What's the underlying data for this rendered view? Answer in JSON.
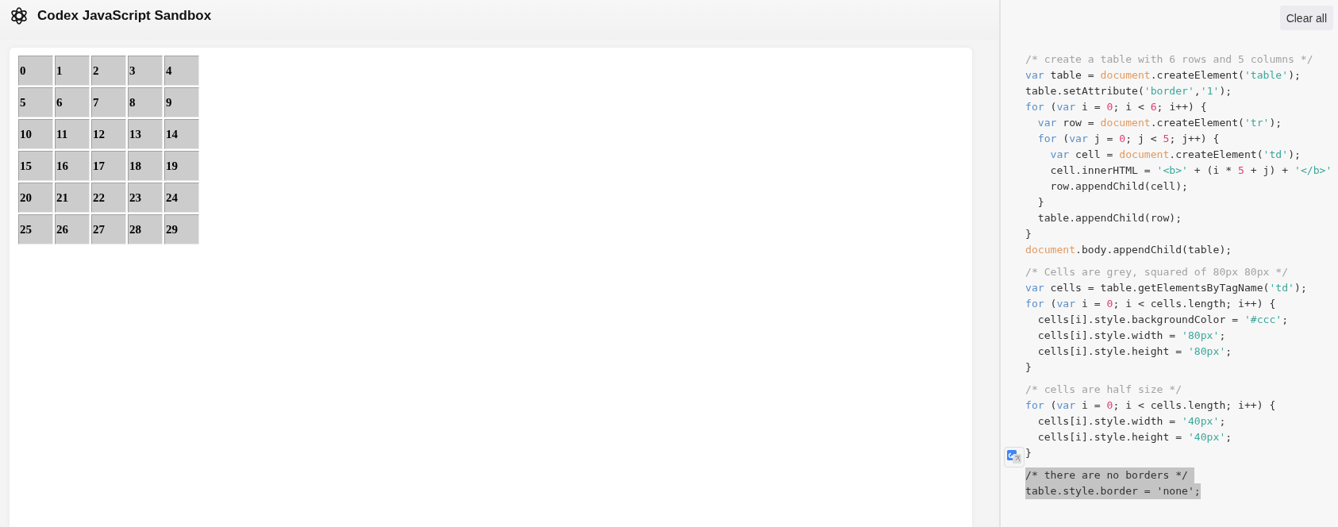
{
  "header": {
    "title": "Codex JavaScript Sandbox"
  },
  "output_table": {
    "rows": [
      [
        "0",
        "1",
        "2",
        "3",
        "4"
      ],
      [
        "5",
        "6",
        "7",
        "8",
        "9"
      ],
      [
        "10",
        "11",
        "12",
        "13",
        "14"
      ],
      [
        "15",
        "16",
        "17",
        "18",
        "19"
      ],
      [
        "20",
        "21",
        "22",
        "23",
        "24"
      ],
      [
        "25",
        "26",
        "27",
        "28",
        "29"
      ]
    ]
  },
  "clear_button": {
    "label": "Clear all"
  },
  "code": {
    "blocks": [
      {
        "highlighted": false,
        "lines": [
          [
            {
              "kind": "comment",
              "text": "/* create a table with 6 rows and 5 columns */"
            }
          ],
          [
            {
              "kind": "keyword",
              "text": "var"
            },
            {
              "kind": "plain",
              "text": " table = "
            },
            {
              "kind": "builtin",
              "text": "document"
            },
            {
              "kind": "plain",
              "text": ".createElement("
            },
            {
              "kind": "string",
              "text": "'table'"
            },
            {
              "kind": "plain",
              "text": ");"
            }
          ],
          [
            {
              "kind": "plain",
              "text": "table.setAttribute("
            },
            {
              "kind": "string",
              "text": "'border'"
            },
            {
              "kind": "plain",
              "text": ","
            },
            {
              "kind": "string",
              "text": "'1'"
            },
            {
              "kind": "plain",
              "text": ");"
            }
          ],
          [
            {
              "kind": "keyword",
              "text": "for"
            },
            {
              "kind": "plain",
              "text": " ("
            },
            {
              "kind": "keyword",
              "text": "var"
            },
            {
              "kind": "plain",
              "text": " i = "
            },
            {
              "kind": "number",
              "text": "0"
            },
            {
              "kind": "plain",
              "text": "; i < "
            },
            {
              "kind": "number",
              "text": "6"
            },
            {
              "kind": "plain",
              "text": "; i++) {"
            }
          ],
          [
            {
              "kind": "keyword",
              "text": "  var"
            },
            {
              "kind": "plain",
              "text": " row = "
            },
            {
              "kind": "builtin",
              "text": "document"
            },
            {
              "kind": "plain",
              "text": ".createElement("
            },
            {
              "kind": "string",
              "text": "'tr'"
            },
            {
              "kind": "plain",
              "text": ");"
            }
          ],
          [
            {
              "kind": "keyword",
              "text": "  for"
            },
            {
              "kind": "plain",
              "text": " ("
            },
            {
              "kind": "keyword",
              "text": "var"
            },
            {
              "kind": "plain",
              "text": " j = "
            },
            {
              "kind": "number",
              "text": "0"
            },
            {
              "kind": "plain",
              "text": "; j < "
            },
            {
              "kind": "number",
              "text": "5"
            },
            {
              "kind": "plain",
              "text": "; j++) {"
            }
          ],
          [
            {
              "kind": "keyword",
              "text": "    var"
            },
            {
              "kind": "plain",
              "text": " cell = "
            },
            {
              "kind": "builtin",
              "text": "document"
            },
            {
              "kind": "plain",
              "text": ".createElement("
            },
            {
              "kind": "string",
              "text": "'td'"
            },
            {
              "kind": "plain",
              "text": ");"
            }
          ],
          [
            {
              "kind": "plain",
              "text": "    cell.innerHTML = "
            },
            {
              "kind": "string",
              "text": "'<b>'"
            },
            {
              "kind": "plain",
              "text": " + (i * "
            },
            {
              "kind": "number",
              "text": "5"
            },
            {
              "kind": "plain",
              "text": " + j) + "
            },
            {
              "kind": "string",
              "text": "'</b>'"
            }
          ],
          [
            {
              "kind": "plain",
              "text": "    row.appendChild(cell);"
            }
          ],
          [
            {
              "kind": "plain",
              "text": "  }"
            }
          ],
          [
            {
              "kind": "plain",
              "text": "  table.appendChild(row);"
            }
          ],
          [
            {
              "kind": "plain",
              "text": "}"
            }
          ],
          [
            {
              "kind": "builtin",
              "text": "document"
            },
            {
              "kind": "plain",
              "text": ".body.appendChild(table);"
            }
          ]
        ]
      },
      {
        "highlighted": false,
        "lines": [
          [
            {
              "kind": "comment",
              "text": "/* Cells are grey, squared of 80px 80px */"
            }
          ],
          [
            {
              "kind": "keyword",
              "text": "var"
            },
            {
              "kind": "plain",
              "text": " cells = table.getElementsByTagName("
            },
            {
              "kind": "string",
              "text": "'td'"
            },
            {
              "kind": "plain",
              "text": ");"
            }
          ],
          [
            {
              "kind": "keyword",
              "text": "for"
            },
            {
              "kind": "plain",
              "text": " ("
            },
            {
              "kind": "keyword",
              "text": "var"
            },
            {
              "kind": "plain",
              "text": " i = "
            },
            {
              "kind": "number",
              "text": "0"
            },
            {
              "kind": "plain",
              "text": "; i < cells.length; i++) {"
            }
          ],
          [
            {
              "kind": "plain",
              "text": "  cells[i].style.backgroundColor = "
            },
            {
              "kind": "string",
              "text": "'#ccc'"
            },
            {
              "kind": "plain",
              "text": ";"
            }
          ],
          [
            {
              "kind": "plain",
              "text": "  cells[i].style.width = "
            },
            {
              "kind": "string",
              "text": "'80px'"
            },
            {
              "kind": "plain",
              "text": ";"
            }
          ],
          [
            {
              "kind": "plain",
              "text": "  cells[i].style.height = "
            },
            {
              "kind": "string",
              "text": "'80px'"
            },
            {
              "kind": "plain",
              "text": ";"
            }
          ],
          [
            {
              "kind": "plain",
              "text": "}"
            }
          ]
        ]
      },
      {
        "highlighted": false,
        "lines": [
          [
            {
              "kind": "comment",
              "text": "/* cells are half size */"
            }
          ],
          [
            {
              "kind": "keyword",
              "text": "for"
            },
            {
              "kind": "plain",
              "text": " ("
            },
            {
              "kind": "keyword",
              "text": "var"
            },
            {
              "kind": "plain",
              "text": " i = "
            },
            {
              "kind": "number",
              "text": "0"
            },
            {
              "kind": "plain",
              "text": "; i < cells.length; i++) {"
            }
          ],
          [
            {
              "kind": "plain",
              "text": "  cells[i].style.width = "
            },
            {
              "kind": "string",
              "text": "'40px'"
            },
            {
              "kind": "plain",
              "text": ";"
            }
          ],
          [
            {
              "kind": "plain",
              "text": "  cells[i].style.height = "
            },
            {
              "kind": "string",
              "text": "'40px'"
            },
            {
              "kind": "plain",
              "text": ";"
            }
          ],
          [
            {
              "kind": "plain",
              "text": "}"
            }
          ]
        ]
      },
      {
        "highlighted": true,
        "lines": [
          [
            {
              "kind": "plain",
              "text": "/* there are no borders */ "
            }
          ],
          [
            {
              "kind": "plain",
              "text": "table.style.border = 'none';"
            }
          ]
        ]
      }
    ]
  }
}
